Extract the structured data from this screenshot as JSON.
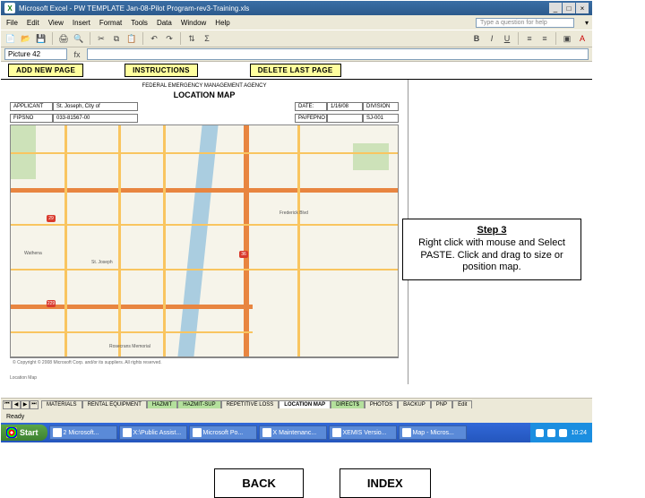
{
  "titlebar": {
    "app_icon": "X",
    "title": "Microsoft Excel - PW TEMPLATE Jan-08-Pilot Program-rev3-Training.xls"
  },
  "menubar": {
    "items": [
      "File",
      "Edit",
      "View",
      "Insert",
      "Format",
      "Tools",
      "Data",
      "Window",
      "Help"
    ],
    "help_placeholder": "Type a question for help"
  },
  "toolbar": {
    "font_letter": "A"
  },
  "namebox": {
    "value": "Picture 42"
  },
  "action_buttons": {
    "add": "ADD NEW PAGE",
    "instructions": "INSTRUCTIONS",
    "delete": "DELETE LAST PAGE"
  },
  "doc": {
    "agency": "FEDERAL EMERGENCY MANAGEMENT AGENCY",
    "title": "LOCATION MAP",
    "row1": {
      "l1": "APPLICANT",
      "l2": "St. Joseph, City of",
      "date_l": "DATE:",
      "date_v": "1/16/08",
      "div": "DIVISION"
    },
    "row2": {
      "l1": "FIPSNO",
      "l2": "033-81567-00",
      "pw_l": "PA/FEPNO",
      "pw_v": "",
      "sj": "SJ-001"
    },
    "copyright": "© Copyright © 2008 Microsoft Corp. and/or its suppliers. All rights reserved.",
    "caption": "Location Map"
  },
  "callout": {
    "step": "Step 3",
    "text": "Right click with mouse and Select PASTE. Click and drag to size or position map."
  },
  "tabs": {
    "items": [
      "MATERIALS",
      "RENTAL EQUIPMENT",
      "HAZMIT",
      "HAZMIT-SUP",
      "REPETITIVE LOSS",
      "LOCATION MAP",
      "DIRECT$",
      "PHOTOS",
      "BACKUP",
      "PNP",
      "Edit"
    ]
  },
  "statusbar": {
    "text": "Ready"
  },
  "taskbar": {
    "start": "Start",
    "tasks": [
      "2 Microsoft...",
      "X:\\Public Assist...",
      "Microsoft Po...",
      "X Maintenanc...",
      "XEMIS Versio...",
      "Map - Micros..."
    ],
    "clock": "10:24"
  },
  "bottom_nav": {
    "back": "BACK",
    "index": "INDEX"
  }
}
